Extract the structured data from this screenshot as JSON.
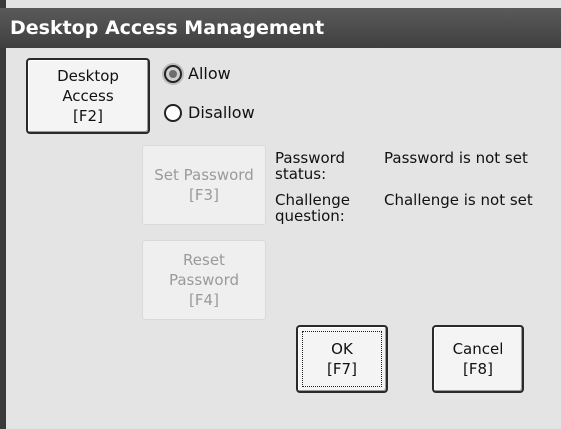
{
  "window": {
    "title": "Desktop Access Management"
  },
  "buttons": {
    "desktop_access": "Desktop\nAccess\n[F2]",
    "set_password": "Set Password\n[F3]",
    "reset_password": "Reset\nPassword\n[F4]",
    "ok": "OK\n[F7]",
    "cancel": "Cancel\n[F8]"
  },
  "access": {
    "allow_label": "Allow",
    "disallow_label": "Disallow",
    "selected": "Allow"
  },
  "status": {
    "password_label": "Password\nstatus:",
    "password_value": "Password is not set",
    "challenge_label": "Challenge\nquestion:",
    "challenge_value": "Challenge is not set"
  },
  "colors": {
    "titlebar": "#4a4a4a",
    "dialog_background": "#e4e4e4",
    "disabled_text": "#9a9a9a"
  }
}
